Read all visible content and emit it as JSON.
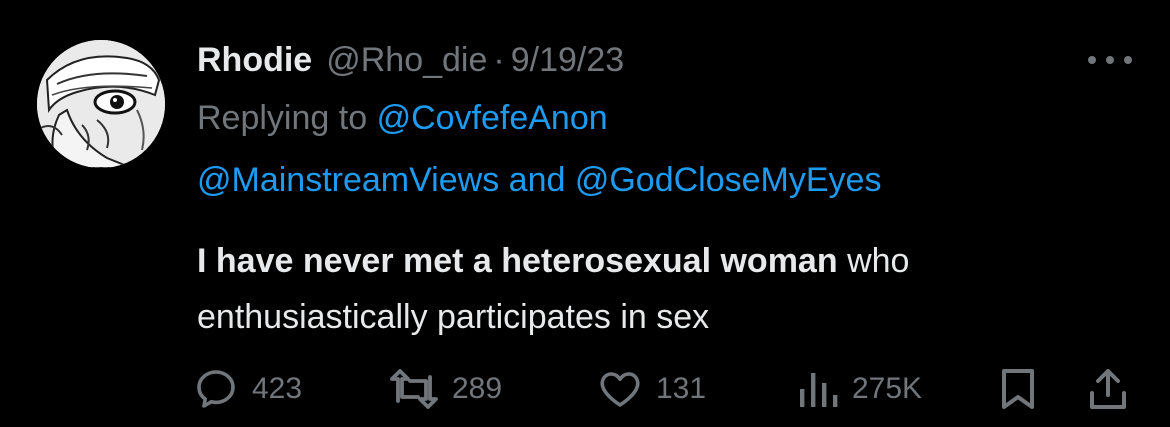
{
  "tweet": {
    "author_name": "Rhodie",
    "handle": "@Rho_die",
    "separator": "·",
    "date": "9/19/23",
    "replying_prefix": "Replying to",
    "reply_mention_1": "@CovfefeAnon",
    "reply_mention_2": "@MainstreamViews",
    "reply_and": "and",
    "reply_mention_3": "@GodCloseMyEyes",
    "text_bold": "I have never met a heterosexual woman",
    "text_rest": "who enthusiastically participates in sex"
  },
  "actions": {
    "replies": "423",
    "retweets": "289",
    "likes": "131",
    "views": "275K"
  },
  "icons": {
    "more": "more-horizontal-icon",
    "reply": "reply-icon",
    "retweet": "retweet-icon",
    "like": "heart-icon",
    "views": "bar-chart-icon",
    "bookmark": "bookmark-icon",
    "share": "share-icon"
  },
  "colors": {
    "background": "#000000",
    "text_primary": "#e7e9ea",
    "text_secondary": "#71767b",
    "link": "#1d9bf0"
  }
}
